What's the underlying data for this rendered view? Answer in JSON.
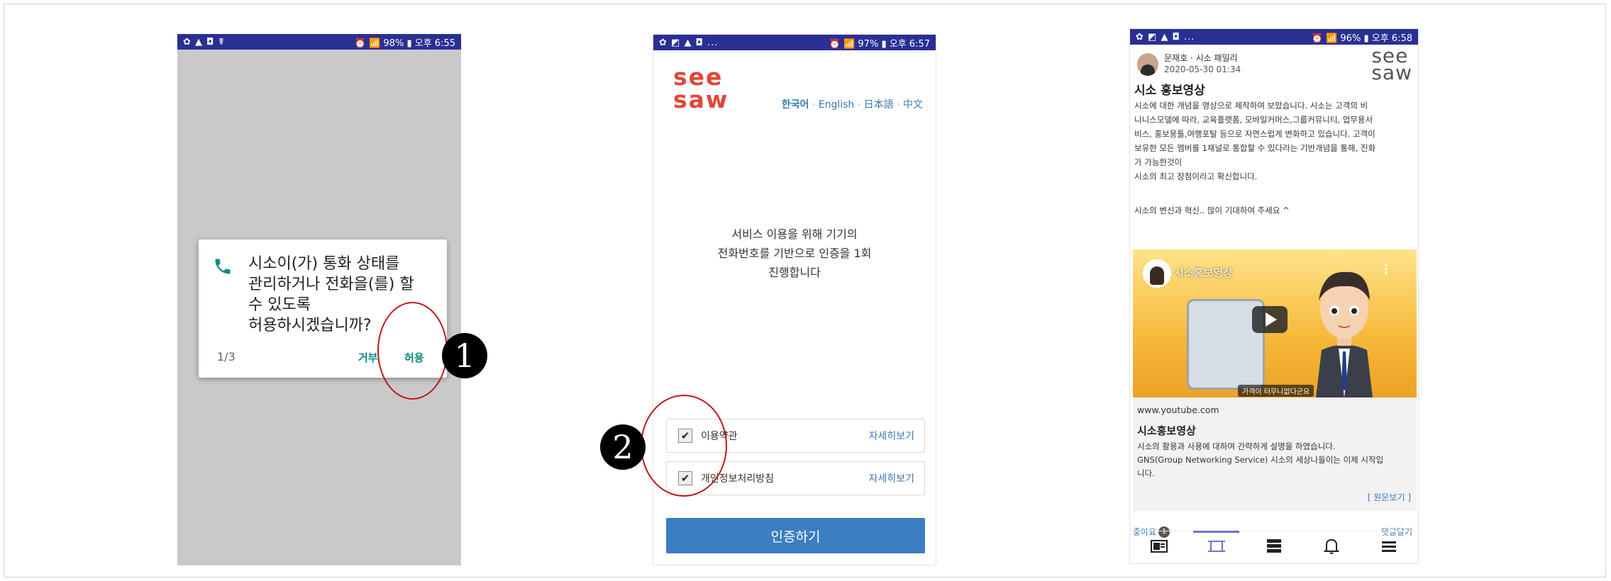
{
  "phone1": {
    "status": {
      "left": "✿ ▲ ◘ ☤",
      "right": "⏰ 📶 98% ▮ 오후 6:55"
    },
    "dialog": {
      "message": "시소이(가) 통화 상태를\n관리하거나 전화을(를) 할\n수 있도록\n허용하시겠습니까?",
      "counter": "1/3",
      "deny": "거부",
      "allow": "허용"
    },
    "icon": "phone-icon"
  },
  "phone2": {
    "status": {
      "left": "✿ ◩ ▲ ◘ ...",
      "right": "⏰ 📶 97% ▮ 오후 6:57"
    },
    "logo": "see\nsaw",
    "langs": {
      "ko": "한국어",
      "en": "English",
      "ja": "日本語",
      "zh": "中文",
      "sep": " · "
    },
    "message": "서비스 이용을 위해 기기의\n전화번호를 기반으로 인증을 1회\n진행합니다",
    "terms": {
      "label": "이용약관",
      "detail": "자세히보기",
      "checked": true
    },
    "privacy": {
      "label": "개인정보처리방침",
      "detail": "자세히보기",
      "checked": true
    },
    "auth_button": "인증하기"
  },
  "phone3": {
    "status": {
      "left": "✿ ◩ ▲ ◘ ...",
      "right": "⏰ 📶 96% ▮ 오후 6:58"
    },
    "author": "문재호 · 시소 패밀리",
    "date": "2020-05-30 01:34",
    "logo": "see\nsaw",
    "title": "시소 홍보영상",
    "body": "시소에 대한 개념을 영상으로 제작하여 보았습니다. 시소는 고객의 비\n니니스모델에 따라, 교육플랫폼, 모바일커머스,그룹커뮤니티, 업무용서\n비스, 홍보용툴,여행포탈 등으로 자연스럽게 변화하고 있습니다. 고객이\n보유한 모든 멤버를 1채널로 통합할 수 있다라는 기반개념을 통해, 진화\n가 가능한것이\n시소의 최고 장점이라고 확신합니다.",
    "note": "시소의 변신과 혁신.. 많이 기대하여 주세요 ^",
    "video": {
      "title": "시소홍보영상",
      "caption": "가격이 터무니없다군요"
    },
    "link": {
      "url": "www.youtube.com",
      "title": "시소홍보영상",
      "desc": "시소의 활용과 사용에 대하여 간략하게 설명을 하였습니다.\nGNS(Group Networking Service) 시소의 세상나들이는 이제 시작입\n니다.",
      "original": "[ 원문보기 ]"
    },
    "like_label": "좋아요",
    "like_count": "1",
    "comment_label": "댓글달기",
    "tabs": [
      "news-icon",
      "frame-icon",
      "server-icon",
      "bell-icon",
      "menu-icon"
    ]
  },
  "annotations": {
    "one": "1",
    "two": "2"
  },
  "colors": {
    "status_bar": "#2a2f93",
    "brand_red": "#e24638",
    "link_blue": "#3a79b8",
    "button_blue": "#3b7ec2",
    "ring_red": "#c0161a"
  }
}
